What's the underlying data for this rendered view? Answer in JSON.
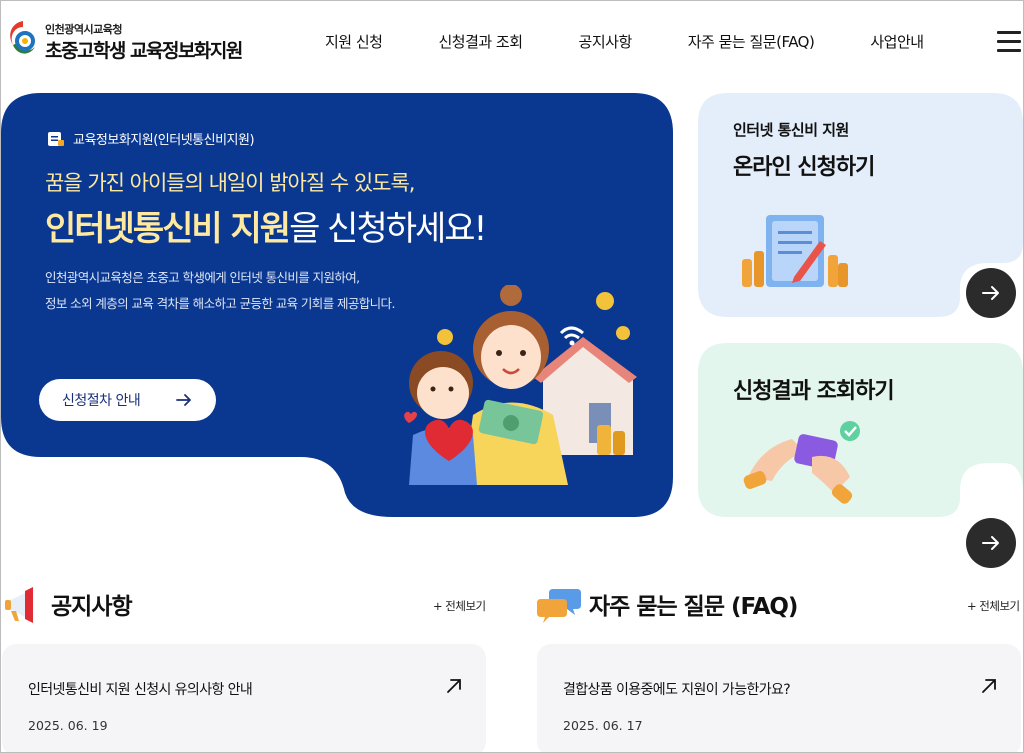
{
  "header": {
    "org_small": "인천광역시교육청",
    "org_title": "초중고학생 교육정보화지원",
    "nav": [
      "지원 신청",
      "신청결과 조회",
      "공지사항",
      "자주 묻는 질문(FAQ)",
      "사업안내"
    ],
    "menu_icon": "hamburger-menu-icon"
  },
  "hero": {
    "label": "교육정보화지원(인터넷통신비지원)",
    "subtitle": "꿈을 가진 아이들의 내일이 밝아질 수 있도록,",
    "title_bold": "인터넷통신비 지원",
    "title_rest": "을 신청하세요!",
    "desc_line1": "인천광역시교육청은 초중고 학생에게 인터넷 통신비를 지원하여,",
    "desc_line2": "정보 소외 계층의 교육 격차를 해소하고 균등한 교육 기회를 제공합니다.",
    "button_label": "신청절차 안내",
    "bg_color": "#0a3890"
  },
  "cards": [
    {
      "small": "인터넷 통신비 지원",
      "big": "온라인 신청하기",
      "bg_color": "#e4eefb"
    },
    {
      "small": "",
      "big": "신청결과 조회하기",
      "bg_color": "#e3f6ee"
    }
  ],
  "notice": {
    "title": "공지사항",
    "more": "+ 전체보기",
    "post_title": "인터넷통신비 지원 신청시 유의사항 안내",
    "post_date": "2025. 06. 19"
  },
  "faq": {
    "title": "자주 묻는 질문 (FAQ)",
    "more": "+ 전체보기",
    "post_title": "결합상품 이용중에도 지원이 가능한가요?",
    "post_date": "2025. 06. 17"
  }
}
